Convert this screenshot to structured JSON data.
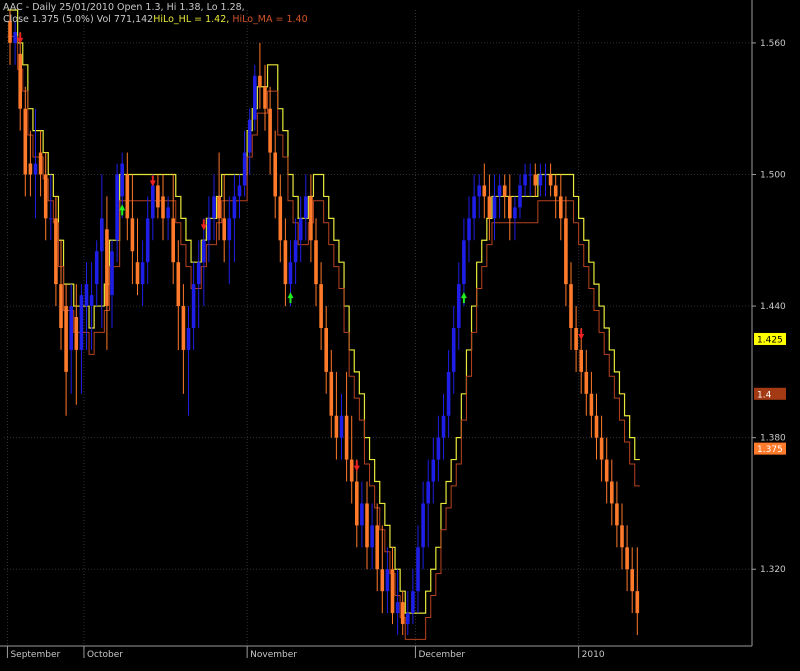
{
  "header": {
    "line1": "AAC - Daily 25/01/2010 Open 1.3, Hi 1.38, Lo 1.28,",
    "line2_prefix": "Close 1.375 (5.0%) Vol 771,142",
    "hilo_hl": "HiLo_HL = 1.42,",
    "hilo_ma": "HiLo_MA = 1.40"
  },
  "colors": {
    "background": "#000000",
    "grid": "#303030",
    "up_candle": "#1e1ee6",
    "down_candle": "#ff7a2a",
    "hilo_hl_line": "#e8e83a",
    "hilo_ma_line": "#b8431f",
    "buy_arrow": "#22ee22",
    "sell_arrow": "#ee2222",
    "axis_text": "#c8c8c8"
  },
  "chart_data": {
    "type": "candlestick",
    "y_ticks": [
      "1.560",
      "1.500",
      "1.440",
      "1.380",
      "1.320"
    ],
    "ylim": [
      1.285,
      1.575
    ],
    "x_month_labels": [
      {
        "label": "September",
        "index": 0
      },
      {
        "label": "October",
        "index": 15
      },
      {
        "label": "November",
        "index": 47
      },
      {
        "label": "December",
        "index": 80
      },
      {
        "label": "2010",
        "index": 112
      }
    ],
    "price_labels": [
      {
        "text": "1.425",
        "value": 1.425,
        "bg": "#ffff00",
        "fg": "#000000"
      },
      {
        "text": "1.4",
        "value": 1.4,
        "bg": "#a43a14",
        "fg": "#ffffff"
      },
      {
        "text": "1.375",
        "value": 1.375,
        "bg": "#ff7a2a",
        "fg": "#ffffff"
      }
    ],
    "gap_start": 124,
    "gap_end": 126,
    "candles": [
      [
        1.57,
        1.575,
        1.55,
        1.56
      ],
      [
        1.56,
        1.57,
        1.55,
        1.565
      ],
      [
        1.555,
        1.565,
        1.52,
        1.53
      ],
      [
        1.53,
        1.54,
        1.49,
        1.5
      ],
      [
        1.505,
        1.52,
        1.49,
        1.5
      ],
      [
        1.5,
        1.53,
        1.48,
        1.505
      ],
      [
        1.51,
        1.52,
        1.49,
        1.5
      ],
      [
        1.5,
        1.51,
        1.47,
        1.48
      ],
      [
        1.48,
        1.5,
        1.47,
        1.48
      ],
      [
        1.48,
        1.49,
        1.44,
        1.45
      ],
      [
        1.45,
        1.47,
        1.42,
        1.43
      ],
      [
        1.44,
        1.45,
        1.39,
        1.41
      ],
      [
        1.42,
        1.45,
        1.4,
        1.44
      ],
      [
        1.435,
        1.45,
        1.395,
        1.42
      ],
      [
        1.42,
        1.45,
        1.4,
        1.445
      ],
      [
        1.44,
        1.46,
        1.42,
        1.45
      ],
      [
        1.44,
        1.46,
        1.42,
        1.445
      ],
      [
        1.45,
        1.47,
        1.44,
        1.465
      ],
      [
        1.465,
        1.5,
        1.43,
        1.48
      ],
      [
        1.475,
        1.49,
        1.42,
        1.44
      ],
      [
        1.445,
        1.47,
        1.43,
        1.465
      ],
      [
        1.47,
        1.505,
        1.46,
        1.5
      ],
      [
        1.49,
        1.51,
        1.48,
        1.505
      ],
      [
        1.5,
        1.51,
        1.47,
        1.48
      ],
      [
        1.48,
        1.5,
        1.45,
        1.465
      ],
      [
        1.46,
        1.48,
        1.445,
        1.45
      ],
      [
        1.45,
        1.47,
        1.44,
        1.46
      ],
      [
        1.46,
        1.49,
        1.45,
        1.48
      ],
      [
        1.48,
        1.5,
        1.47,
        1.495
      ],
      [
        1.495,
        1.5,
        1.48,
        1.485
      ],
      [
        1.49,
        1.5,
        1.47,
        1.48
      ],
      [
        1.48,
        1.49,
        1.47,
        1.485
      ],
      [
        1.48,
        1.5,
        1.45,
        1.46
      ],
      [
        1.46,
        1.47,
        1.42,
        1.44
      ],
      [
        1.44,
        1.45,
        1.4,
        1.42
      ],
      [
        1.42,
        1.44,
        1.39,
        1.43
      ],
      [
        1.43,
        1.46,
        1.42,
        1.45
      ],
      [
        1.45,
        1.47,
        1.43,
        1.46
      ],
      [
        1.46,
        1.48,
        1.44,
        1.47
      ],
      [
        1.47,
        1.49,
        1.46,
        1.48
      ],
      [
        1.48,
        1.5,
        1.47,
        1.49
      ],
      [
        1.49,
        1.51,
        1.47,
        1.48
      ],
      [
        1.48,
        1.5,
        1.46,
        1.47
      ],
      [
        1.47,
        1.49,
        1.45,
        1.48
      ],
      [
        1.48,
        1.5,
        1.46,
        1.49
      ],
      [
        1.49,
        1.5,
        1.48,
        1.495
      ],
      [
        1.495,
        1.52,
        1.49,
        1.51
      ],
      [
        1.51,
        1.53,
        1.5,
        1.525
      ],
      [
        1.525,
        1.55,
        1.52,
        1.545
      ],
      [
        1.545,
        1.56,
        1.53,
        1.54
      ],
      [
        1.54,
        1.55,
        1.52,
        1.53
      ],
      [
        1.53,
        1.54,
        1.5,
        1.51
      ],
      [
        1.51,
        1.52,
        1.48,
        1.49
      ],
      [
        1.49,
        1.5,
        1.46,
        1.47
      ],
      [
        1.47,
        1.48,
        1.44,
        1.45
      ],
      [
        1.45,
        1.47,
        1.44,
        1.46
      ],
      [
        1.46,
        1.48,
        1.45,
        1.47
      ],
      [
        1.47,
        1.49,
        1.46,
        1.48
      ],
      [
        1.48,
        1.5,
        1.47,
        1.49
      ],
      [
        1.49,
        1.5,
        1.46,
        1.47
      ],
      [
        1.47,
        1.48,
        1.44,
        1.45
      ],
      [
        1.45,
        1.46,
        1.42,
        1.43
      ],
      [
        1.43,
        1.44,
        1.4,
        1.41
      ],
      [
        1.41,
        1.42,
        1.38,
        1.39
      ],
      [
        1.39,
        1.41,
        1.37,
        1.38
      ],
      [
        1.38,
        1.4,
        1.37,
        1.39
      ],
      [
        1.39,
        1.41,
        1.36,
        1.37
      ],
      [
        1.37,
        1.39,
        1.35,
        1.36
      ],
      [
        1.36,
        1.37,
        1.33,
        1.34
      ],
      [
        1.34,
        1.36,
        1.33,
        1.35
      ],
      [
        1.35,
        1.36,
        1.32,
        1.33
      ],
      [
        1.33,
        1.35,
        1.32,
        1.34
      ],
      [
        1.34,
        1.35,
        1.31,
        1.32
      ],
      [
        1.32,
        1.34,
        1.3,
        1.31
      ],
      [
        1.31,
        1.33,
        1.3,
        1.32
      ],
      [
        1.32,
        1.33,
        1.295,
        1.3
      ],
      [
        1.3,
        1.32,
        1.29,
        1.305
      ],
      [
        1.305,
        1.31,
        1.29,
        1.295
      ],
      [
        1.295,
        1.31,
        1.29,
        1.3
      ],
      [
        1.3,
        1.32,
        1.295,
        1.31
      ],
      [
        1.31,
        1.34,
        1.3,
        1.33
      ],
      [
        1.33,
        1.36,
        1.32,
        1.35
      ],
      [
        1.35,
        1.37,
        1.33,
        1.36
      ],
      [
        1.36,
        1.38,
        1.35,
        1.37
      ],
      [
        1.37,
        1.39,
        1.36,
        1.38
      ],
      [
        1.38,
        1.4,
        1.37,
        1.39
      ],
      [
        1.39,
        1.42,
        1.38,
        1.41
      ],
      [
        1.41,
        1.44,
        1.4,
        1.43
      ],
      [
        1.43,
        1.46,
        1.42,
        1.45
      ],
      [
        1.45,
        1.48,
        1.44,
        1.47
      ],
      [
        1.47,
        1.49,
        1.46,
        1.48
      ],
      [
        1.48,
        1.5,
        1.47,
        1.49
      ],
      [
        1.49,
        1.5,
        1.48,
        1.495
      ],
      [
        1.495,
        1.505,
        1.48,
        1.49
      ],
      [
        1.49,
        1.5,
        1.47,
        1.48
      ],
      [
        1.48,
        1.5,
        1.47,
        1.49
      ],
      [
        1.49,
        1.5,
        1.48,
        1.495
      ],
      [
        1.495,
        1.5,
        1.48,
        1.49
      ],
      [
        1.49,
        1.5,
        1.47,
        1.48
      ],
      [
        1.48,
        1.49,
        1.47,
        1.485
      ],
      [
        1.485,
        1.5,
        1.48,
        1.495
      ],
      [
        1.495,
        1.505,
        1.49,
        1.5
      ],
      [
        1.5,
        1.505,
        1.49,
        1.5
      ],
      [
        1.5,
        1.505,
        1.49,
        1.495
      ],
      [
        1.495,
        1.505,
        1.49,
        1.5
      ],
      [
        1.5,
        1.505,
        1.49,
        1.5
      ],
      [
        1.5,
        1.505,
        1.49,
        1.495
      ],
      [
        1.495,
        1.5,
        1.48,
        1.49
      ],
      [
        1.49,
        1.5,
        1.47,
        1.48
      ],
      [
        1.48,
        1.49,
        1.44,
        1.45
      ],
      [
        1.45,
        1.46,
        1.42,
        1.43
      ],
      [
        1.43,
        1.44,
        1.41,
        1.42
      ],
      [
        1.42,
        1.43,
        1.4,
        1.41
      ],
      [
        1.41,
        1.42,
        1.39,
        1.4
      ],
      [
        1.4,
        1.41,
        1.38,
        1.39
      ],
      [
        1.39,
        1.4,
        1.37,
        1.38
      ],
      [
        1.38,
        1.39,
        1.36,
        1.37
      ],
      [
        1.37,
        1.38,
        1.35,
        1.36
      ],
      [
        1.36,
        1.37,
        1.34,
        1.35
      ],
      [
        1.35,
        1.36,
        1.33,
        1.34
      ],
      [
        1.34,
        1.35,
        1.32,
        1.33
      ],
      [
        1.33,
        1.34,
        1.31,
        1.32
      ],
      [
        1.32,
        1.33,
        1.3,
        1.31
      ],
      [
        1.31,
        1.33,
        1.29,
        1.3
      ],
      [
        1.3,
        1.38,
        1.28,
        1.375
      ]
    ],
    "hilo_hl": [
      1.575,
      1.575,
      1.56,
      1.55,
      1.53,
      1.52,
      1.52,
      1.51,
      1.5,
      1.49,
      1.47,
      1.45,
      1.45,
      1.44,
      1.44,
      1.44,
      1.43,
      1.44,
      1.44,
      1.45,
      1.47,
      1.47,
      1.5,
      1.5,
      1.5,
      1.5,
      1.5,
      1.5,
      1.5,
      1.5,
      1.5,
      1.5,
      1.5,
      1.49,
      1.48,
      1.47,
      1.46,
      1.46,
      1.47,
      1.48,
      1.48,
      1.49,
      1.5,
      1.5,
      1.5,
      1.5,
      1.5,
      1.52,
      1.53,
      1.54,
      1.54,
      1.55,
      1.55,
      1.53,
      1.52,
      1.5,
      1.49,
      1.48,
      1.48,
      1.49,
      1.5,
      1.5,
      1.49,
      1.48,
      1.47,
      1.46,
      1.44,
      1.42,
      1.41,
      1.4,
      1.38,
      1.37,
      1.36,
      1.35,
      1.34,
      1.33,
      1.32,
      1.31,
      1.3,
      1.3,
      1.3,
      1.3,
      1.31,
      1.32,
      1.33,
      1.35,
      1.36,
      1.37,
      1.38,
      1.4,
      1.42,
      1.44,
      1.46,
      1.47,
      1.48,
      1.49,
      1.49,
      1.49,
      1.49,
      1.49,
      1.49,
      1.49,
      1.49,
      1.49,
      1.5,
      1.5,
      1.5,
      1.5,
      1.5,
      1.5,
      1.5,
      1.49,
      1.48,
      1.47,
      1.46,
      1.45,
      1.44,
      1.43,
      1.42,
      1.41,
      1.4,
      1.39,
      1.38,
      1.37,
      1.36,
      1.35,
      1.34
    ]
  }
}
